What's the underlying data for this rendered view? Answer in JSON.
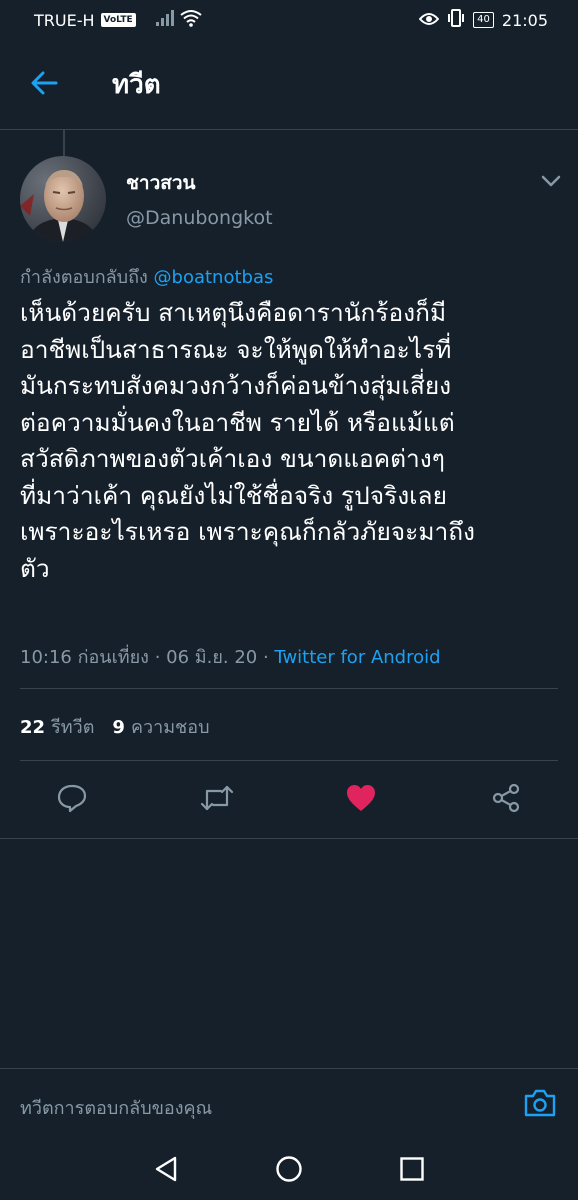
{
  "status_bar": {
    "carrier": "TRUE-H",
    "volte": "VoLTE",
    "battery": "40",
    "time": "21:05"
  },
  "header": {
    "title": "ทวีต"
  },
  "tweet": {
    "author_name": "ชาวสวน",
    "author_handle": "@Danubongkot",
    "reply_prefix": "กำลังตอบกลับถึง",
    "reply_mention": "@boatnotbas",
    "text_lines": [
      "เห็นด้วยครับ สาเหตุนึงคือดารานักร้องก็มี",
      "อาชีพเป็นสาธารณะ จะให้พูดให้ทำอะไรที่",
      "มันกระทบสังคมวงกว้างก็ค่อนข้างสุ่มเสี่ยง",
      "ต่อความมั่นคงในอาชีพ รายได้ หรือแม้แต่",
      "สวัสดิภาพของตัวเค้าเอง ขนาดแอคต่างๆ",
      "ที่มาว่าเค้า คุณยังไม่ใช้ชื่อจริง รูปจริงเลย",
      "เพราะอะไรเหรอ เพราะคุณก็กลัวภัยจะมาถึง",
      "ตัว"
    ],
    "time": "10:16 ก่อนเที่ยง",
    "separator": " · ",
    "date": "06 มิ.ย. 20",
    "source": "Twitter for Android",
    "retweet_count": "22",
    "retweet_label": "รีทวีต",
    "like_count": "9",
    "like_label": "ความชอบ",
    "liked": true,
    "like_color": "#e0245e"
  },
  "reply_bar": {
    "placeholder": "ทวีตการตอบกลับของคุณ"
  },
  "colors": {
    "background": "#15202b",
    "accent": "#1da1f2",
    "secondary_text": "#8899a6",
    "divider": "#38444d"
  }
}
